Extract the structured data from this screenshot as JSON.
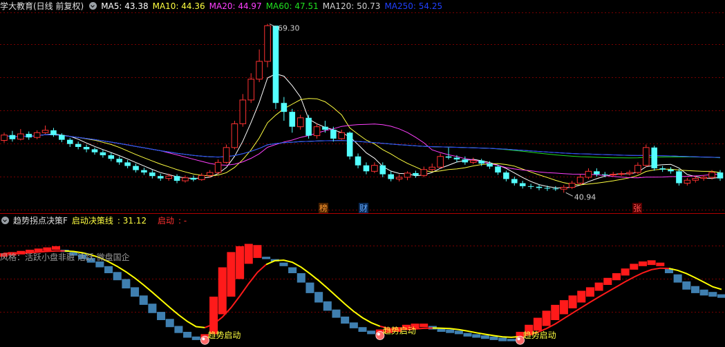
{
  "chart_data": [
    {
      "type": "candlestick",
      "title": "学大教育(日线 前复权)",
      "ma_labels": [
        {
          "name": "MA5",
          "value": "43.38",
          "color": "#ffffff"
        },
        {
          "name": "MA10",
          "value": "44.36",
          "color": "#ffff40"
        },
        {
          "name": "MA20",
          "value": "44.97",
          "color": "#ff40ff"
        },
        {
          "name": "MA60",
          "value": "47.51",
          "color": "#20e020"
        },
        {
          "name": "MA120",
          "value": "50.73",
          "color": "#d0d0d0"
        },
        {
          "name": "MA250",
          "value": "54.25",
          "color": "#2040ff"
        }
      ],
      "ylim": [
        38.5,
        71
      ],
      "high_label": "69.30",
      "low_label": "40.94",
      "event_labels": [
        "榜",
        "财",
        "张"
      ],
      "candles": [
        [
          49.7,
          50.6,
          51.0,
          49.3
        ],
        [
          50.6,
          49.9,
          51.3,
          49.5
        ],
        [
          49.9,
          50.8,
          51.6,
          49.7
        ],
        [
          50.8,
          50.2,
          51.2,
          49.8
        ],
        [
          50.2,
          51.0,
          51.4,
          49.9
        ],
        [
          51.0,
          51.4,
          52.2,
          50.8
        ],
        [
          51.4,
          50.6,
          51.8,
          50.3
        ],
        [
          50.6,
          49.8,
          50.9,
          49.4
        ],
        [
          49.8,
          49.1,
          50.1,
          48.6
        ],
        [
          49.1,
          48.6,
          49.5,
          48.2
        ],
        [
          48.6,
          48.2,
          49.0,
          47.7
        ],
        [
          48.2,
          47.7,
          48.5,
          47.3
        ],
        [
          47.7,
          47.2,
          48.1,
          46.8
        ],
        [
          47.2,
          46.6,
          47.6,
          46.2
        ],
        [
          46.6,
          46.0,
          47.0,
          45.6
        ],
        [
          46.0,
          45.4,
          46.4,
          45.0
        ],
        [
          45.4,
          44.7,
          45.8,
          44.3
        ],
        [
          44.7,
          44.3,
          45.1,
          43.9
        ],
        [
          44.3,
          43.7,
          44.7,
          43.3
        ],
        [
          43.7,
          43.3,
          44.1,
          42.9
        ],
        [
          43.3,
          43.7,
          44.1,
          42.9
        ],
        [
          43.7,
          42.9,
          44.0,
          42.5
        ],
        [
          42.9,
          43.4,
          43.8,
          42.6
        ],
        [
          43.4,
          43.1,
          43.8,
          42.8
        ],
        [
          43.1,
          43.8,
          44.2,
          42.9
        ],
        [
          43.8,
          44.3,
          44.7,
          43.4
        ],
        [
          44.3,
          46.0,
          46.5,
          44.0
        ],
        [
          46.0,
          48.5,
          49.0,
          45.8
        ],
        [
          48.5,
          52.5,
          53.0,
          48.2
        ],
        [
          52.5,
          56.5,
          57.5,
          52.0
        ],
        [
          56.5,
          60.0,
          61.0,
          56.0
        ],
        [
          60.0,
          63.0,
          65.0,
          59.5
        ],
        [
          63.0,
          69.0,
          69.3,
          62.0
        ],
        [
          69.0,
          56.0,
          69.0,
          55.0
        ],
        [
          56.0,
          54.5,
          57.0,
          53.0
        ],
        [
          54.5,
          52.0,
          55.0,
          51.0
        ],
        [
          52.0,
          53.5,
          54.0,
          51.5
        ],
        [
          53.5,
          50.5,
          54.0,
          50.0
        ],
        [
          50.5,
          52.0,
          52.5,
          50.0
        ],
        [
          52.0,
          51.5,
          53.0,
          51.0
        ],
        [
          51.5,
          50.0,
          52.0,
          49.5
        ],
        [
          50.0,
          51.0,
          51.5,
          49.8
        ],
        [
          51.0,
          47.0,
          51.2,
          46.5
        ],
        [
          47.0,
          45.5,
          47.5,
          45.0
        ],
        [
          45.5,
          44.5,
          46.0,
          44.0
        ],
        [
          44.5,
          45.5,
          46.0,
          44.2
        ],
        [
          45.5,
          44.0,
          46.0,
          43.5
        ],
        [
          44.0,
          43.2,
          44.5,
          42.8
        ],
        [
          43.2,
          43.5,
          44.0,
          42.8
        ],
        [
          43.5,
          44.2,
          44.5,
          43.0
        ],
        [
          44.2,
          43.8,
          44.6,
          43.4
        ],
        [
          43.8,
          44.8,
          45.3,
          43.5
        ],
        [
          44.8,
          45.2,
          45.8,
          44.5
        ],
        [
          45.2,
          47.0,
          47.5,
          45.0
        ],
        [
          47.0,
          46.8,
          48.5,
          46.5
        ],
        [
          46.8,
          46.5,
          47.2,
          46.0
        ],
        [
          46.5,
          46.0,
          47.0,
          45.6
        ],
        [
          46.0,
          46.3,
          46.8,
          45.7
        ],
        [
          46.3,
          45.8,
          46.6,
          45.4
        ],
        [
          45.8,
          45.3,
          46.2,
          44.9
        ],
        [
          45.3,
          44.3,
          45.6,
          43.9
        ],
        [
          44.3,
          43.2,
          44.6,
          42.8
        ],
        [
          43.2,
          42.5,
          43.6,
          42.1
        ],
        [
          42.5,
          42.0,
          42.9,
          41.6
        ],
        [
          42.0,
          41.9,
          42.4,
          41.5
        ],
        [
          41.9,
          41.7,
          42.3,
          41.3
        ],
        [
          41.7,
          41.6,
          42.1,
          41.2
        ],
        [
          41.6,
          41.5,
          42.0,
          41.2
        ],
        [
          41.5,
          41.8,
          42.2,
          40.9
        ],
        [
          41.8,
          42.5,
          42.9,
          41.5
        ],
        [
          42.5,
          43.5,
          44.0,
          42.2
        ],
        [
          43.5,
          44.5,
          45.0,
          43.2
        ],
        [
          44.5,
          44.0,
          45.0,
          43.6
        ],
        [
          44.0,
          43.9,
          44.4,
          43.5
        ],
        [
          43.9,
          44.0,
          44.4,
          43.6
        ],
        [
          44.0,
          44.1,
          44.5,
          43.7
        ],
        [
          44.1,
          44.3,
          44.7,
          43.8
        ],
        [
          44.3,
          45.5,
          46.0,
          44.0
        ],
        [
          45.5,
          48.5,
          49.0,
          45.2
        ],
        [
          48.5,
          45.0,
          48.8,
          44.6
        ],
        [
          45.0,
          44.8,
          45.4,
          44.4
        ],
        [
          44.8,
          44.5,
          45.2,
          44.1
        ],
        [
          44.5,
          42.5,
          44.9,
          42.1
        ],
        [
          42.5,
          43.0,
          43.4,
          42.1
        ],
        [
          43.0,
          43.3,
          43.7,
          42.6
        ],
        [
          43.3,
          43.5,
          43.9,
          42.9
        ],
        [
          43.5,
          44.3,
          44.7,
          43.1
        ],
        [
          44.3,
          43.3,
          44.7,
          42.9
        ]
      ]
    },
    {
      "type": "bar",
      "title": "趋势拐点决策F",
      "line_label": "启动决策线",
      "line_value": "31.12",
      "start_label": "启动",
      "start_value": "-",
      "style_note": "风格：活跃小盘非融 活跃 微盘国企",
      "ylim": [
        0,
        100
      ],
      "annotation": "趋势启动",
      "bars": [
        [
          74,
          77,
          "red"
        ],
        [
          75,
          78,
          "red"
        ],
        [
          76,
          79,
          "red"
        ],
        [
          77,
          80,
          "red"
        ],
        [
          78,
          81,
          "red"
        ],
        [
          79,
          82,
          "red"
        ],
        [
          80,
          83,
          "red"
        ],
        [
          78,
          80,
          "blue"
        ],
        [
          75,
          78,
          "blue"
        ],
        [
          72,
          76,
          "blue"
        ],
        [
          69,
          73,
          "blue"
        ],
        [
          65,
          70,
          "blue"
        ],
        [
          60,
          66,
          "blue"
        ],
        [
          54,
          61,
          "blue"
        ],
        [
          47,
          55,
          "blue"
        ],
        [
          40,
          48,
          "blue"
        ],
        [
          33,
          41,
          "blue"
        ],
        [
          26,
          34,
          "blue"
        ],
        [
          20,
          27,
          "blue"
        ],
        [
          14,
          21,
          "blue"
        ],
        [
          9,
          15,
          "blue"
        ],
        [
          5,
          10,
          "blue"
        ],
        [
          3,
          6,
          "blue"
        ],
        [
          4,
          8,
          "red"
        ],
        [
          8,
          40,
          "red"
        ],
        [
          25,
          65,
          "red"
        ],
        [
          40,
          78,
          "red"
        ],
        [
          55,
          83,
          "red"
        ],
        [
          68,
          85,
          "red"
        ],
        [
          73,
          84,
          "red"
        ],
        [
          72,
          74,
          "blue"
        ],
        [
          70,
          72,
          "blue"
        ],
        [
          66,
          69,
          "blue"
        ],
        [
          60,
          65,
          "blue"
        ],
        [
          52,
          60,
          "blue"
        ],
        [
          43,
          52,
          "blue"
        ],
        [
          35,
          44,
          "blue"
        ],
        [
          28,
          36,
          "blue"
        ],
        [
          22,
          29,
          "blue"
        ],
        [
          17,
          23,
          "blue"
        ],
        [
          13,
          18,
          "blue"
        ],
        [
          10,
          14,
          "blue"
        ],
        [
          8,
          11,
          "blue"
        ],
        [
          8,
          12,
          "red"
        ],
        [
          9,
          13,
          "red"
        ],
        [
          10,
          14,
          "red"
        ],
        [
          12,
          16,
          "red"
        ],
        [
          13,
          17,
          "red"
        ],
        [
          14,
          17,
          "red"
        ],
        [
          12,
          15,
          "blue"
        ],
        [
          10,
          13,
          "blue"
        ],
        [
          9,
          12,
          "blue"
        ],
        [
          8,
          11,
          "blue"
        ],
        [
          6,
          9,
          "blue"
        ],
        [
          5,
          8,
          "blue"
        ],
        [
          4,
          7,
          "blue"
        ],
        [
          3,
          6,
          "blue"
        ],
        [
          2,
          5,
          "blue"
        ],
        [
          2,
          4,
          "blue"
        ],
        [
          4,
          10,
          "red"
        ],
        [
          7,
          16,
          "red"
        ],
        [
          11,
          22,
          "red"
        ],
        [
          15,
          28,
          "red"
        ],
        [
          20,
          33,
          "red"
        ],
        [
          25,
          37,
          "red"
        ],
        [
          30,
          41,
          "red"
        ],
        [
          35,
          45,
          "red"
        ],
        [
          40,
          48,
          "red"
        ],
        [
          45,
          52,
          "red"
        ],
        [
          50,
          56,
          "red"
        ],
        [
          54,
          60,
          "red"
        ],
        [
          58,
          64,
          "red"
        ],
        [
          63,
          68,
          "red"
        ],
        [
          66,
          70,
          "red"
        ],
        [
          67,
          71,
          "red"
        ],
        [
          66,
          69,
          "red"
        ],
        [
          60,
          64,
          "blue"
        ],
        [
          52,
          59,
          "blue"
        ],
        [
          46,
          53,
          "blue"
        ],
        [
          43,
          49,
          "blue"
        ],
        [
          41,
          46,
          "blue"
        ],
        [
          40,
          44,
          "blue"
        ],
        [
          39,
          42,
          "blue"
        ]
      ]
    }
  ]
}
